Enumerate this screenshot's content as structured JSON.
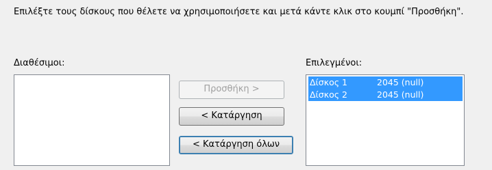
{
  "instructions": "Επιλέξτε τους δίσκους που θέλετε να χρησιμοποιήσετε και μετά κάντε κλικ στο κουμπί \"Προσθήκη\".",
  "available": {
    "label": "Διαθέσιμοι:",
    "items": []
  },
  "selected": {
    "label": "Επιλεγμένοι:",
    "items": [
      {
        "name": "Δίσκος 1",
        "size": "2045 (null)"
      },
      {
        "name": "Δίσκος 2",
        "size": "2045 (null)"
      }
    ]
  },
  "buttons": {
    "add": "Προσθήκη >",
    "remove": "< Κατάργηση",
    "remove_all": "< Κατάργηση όλων"
  },
  "colors": {
    "selection": "#3399ff",
    "background": "#f0f0f0"
  }
}
